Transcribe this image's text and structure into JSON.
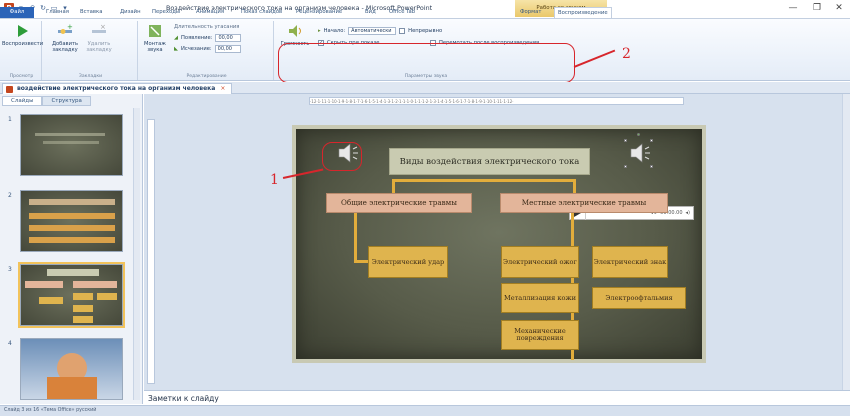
{
  "window": {
    "title": "Воздействие электрического тока на организм человека - Microsoft PowerPoint",
    "context_tab_title": "Работа со звуком",
    "controls": [
      "—",
      "❐",
      "✕"
    ]
  },
  "ribbon_tabs": [
    "Файл",
    "Главная",
    "Вставка",
    "Дизайн",
    "Переходы",
    "Анимация",
    "Показ слайдов",
    "Рецензирование",
    "Вид",
    "Office Tab",
    "Формат",
    "Воспроизведение"
  ],
  "ribbon": {
    "preview": {
      "play_label": "Воспроизвести",
      "group_label": "Просмотр"
    },
    "bookmarks": {
      "add_label": "Добавить закладку",
      "remove_label": "Удалить закладку",
      "group_label": "Закладки"
    },
    "editing": {
      "trim_label": "Монтаж звука",
      "duration_label": "Длительность угасания",
      "fade_in_label": "Появление:",
      "fade_in_value": "00,00",
      "fade_out_label": "Исчезание:",
      "fade_out_value": "00,00",
      "group_label": "Редактирование"
    },
    "audio_options": {
      "volume_label": "Громкость",
      "start_label": "Начало:",
      "start_value": "Автоматически",
      "loop_label": "Непрерывно",
      "hide_label": "Скрыть при показе",
      "rewind_label": "Перемотать после воспроизведения",
      "group_label": "Параметры звука"
    }
  },
  "annotations": {
    "one": "1",
    "two": "2"
  },
  "document_tab": {
    "label": "воздействие электрического тока на организм человека",
    "close": "×"
  },
  "side_panel": {
    "tabs": [
      "Слайды",
      "Структура"
    ],
    "slide_numbers": [
      "1",
      "2",
      "3",
      "4"
    ]
  },
  "ruler_text": "·12·1·11·1·10·1·9·1·8·1·7·1·6·1·5·1·4·1·3·1·2·1·1·1·0·1·1·1·2·1·3·1·4·1·5·1·6·1·7·1·8·1·9·1·10·1·11·1·12·",
  "slide": {
    "title": "Виды воздействия электрического тока",
    "general_injuries": "Общие электрические травмы",
    "local_injuries": "Местные электрические травмы",
    "electric_shock": "Электрический удар",
    "electric_burn": "Электрический ожог",
    "electric_sign": "Электрический знак",
    "skin_metallization": "Металлизация кожи",
    "electrophthalmia": "Электроофтальмия",
    "mechanical_damage": "Механические повреждения",
    "player_time": "00:00.00"
  },
  "notes": {
    "placeholder": "Заметки к слайду"
  },
  "status": {
    "text": "Слайд 3 из 16   «Тема Office»   русский"
  }
}
